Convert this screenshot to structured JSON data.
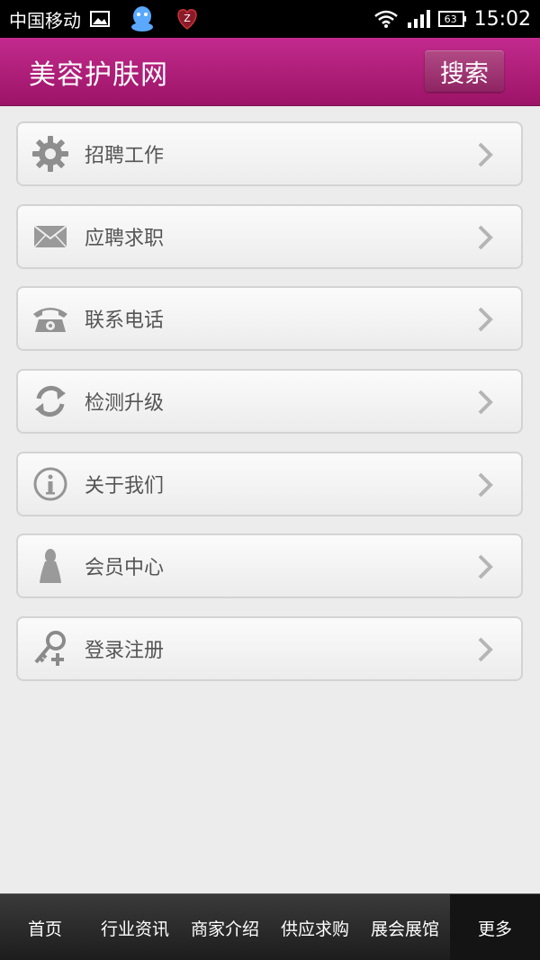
{
  "status_bar": {
    "carrier": "中国移动",
    "battery": "63",
    "time": "15:02"
  },
  "header": {
    "title": "美容护肤网",
    "search_label": "搜索"
  },
  "menu": {
    "items": [
      {
        "label": "招聘工作",
        "icon": "gear-icon"
      },
      {
        "label": "应聘求职",
        "icon": "envelope-icon"
      },
      {
        "label": "联系电话",
        "icon": "telephone-icon"
      },
      {
        "label": "检测升级",
        "icon": "refresh-icon"
      },
      {
        "label": "关于我们",
        "icon": "info-icon"
      },
      {
        "label": "会员中心",
        "icon": "user-icon"
      },
      {
        "label": "登录注册",
        "icon": "key-icon"
      }
    ]
  },
  "bottom_nav": {
    "items": [
      "首页",
      "行业资讯",
      "商家介绍",
      "供应求购",
      "展会展馆",
      "更多"
    ]
  },
  "colors": {
    "header": "#b01f7c",
    "background": "#ececec",
    "nav": "#2a2a2a"
  }
}
